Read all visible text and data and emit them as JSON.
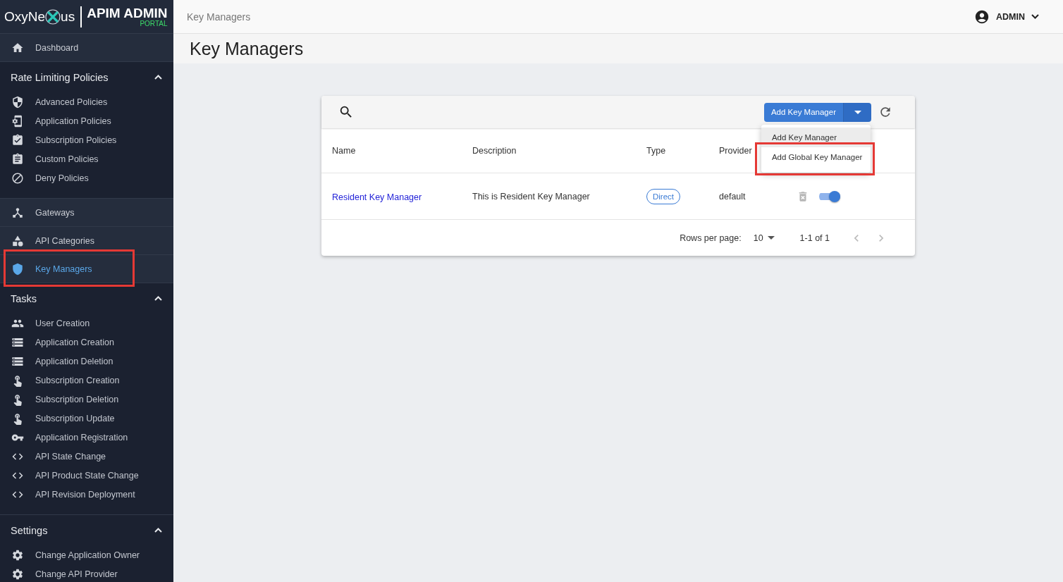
{
  "brand": {
    "logo_start": "OxyNe",
    "logo_end": "us",
    "product": "APIM ADMIN",
    "product_sub": "PORTAL"
  },
  "topbar": {
    "breadcrumb": "Key Managers",
    "user": "ADMIN"
  },
  "page_title": "Key Managers",
  "sidebar": {
    "sections": [
      {
        "kind": "link",
        "label": "Dashboard",
        "selected": false,
        "annotated": false
      },
      {
        "kind": "group",
        "title": "Rate Limiting Policies",
        "expanded": true,
        "items": [
          {
            "label": "Advanced Policies",
            "selected": false
          },
          {
            "label": "Application Policies",
            "selected": false
          },
          {
            "label": "Subscription Policies",
            "selected": false
          },
          {
            "label": "Custom Policies",
            "selected": false
          },
          {
            "label": "Deny Policies",
            "selected": false
          }
        ]
      },
      {
        "kind": "link",
        "label": "Gateways",
        "selected": false,
        "annotated": false
      },
      {
        "kind": "link",
        "label": "API Categories",
        "selected": false,
        "annotated": false
      },
      {
        "kind": "link",
        "label": "Key Managers",
        "selected": true,
        "annotated": true
      },
      {
        "kind": "group",
        "title": "Tasks",
        "expanded": true,
        "items": [
          {
            "label": "User Creation",
            "selected": false
          },
          {
            "label": "Application Creation",
            "selected": false
          },
          {
            "label": "Application Deletion",
            "selected": false
          },
          {
            "label": "Subscription Creation",
            "selected": false
          },
          {
            "label": "Subscription Deletion",
            "selected": false
          },
          {
            "label": "Subscription Update",
            "selected": false
          },
          {
            "label": "Application Registration",
            "selected": false
          },
          {
            "label": "API State Change",
            "selected": false
          },
          {
            "label": "API Product State Change",
            "selected": false
          },
          {
            "label": "API Revision Deployment",
            "selected": false
          }
        ]
      },
      {
        "kind": "group",
        "title": "Settings",
        "expanded": true,
        "items": [
          {
            "label": "Change Application Owner",
            "selected": false
          },
          {
            "label": "Change API Provider",
            "selected": false
          }
        ]
      }
    ]
  },
  "toolbar": {
    "add_button": "Add Key Manager",
    "menu_open": true,
    "menu": [
      {
        "label": "Add Key Manager",
        "hovered": true,
        "annotated": false
      },
      {
        "label": "Add Global Key Manager",
        "hovered": false,
        "annotated": true
      }
    ]
  },
  "table": {
    "columns": [
      "Name",
      "Description",
      "Type",
      "Provider"
    ],
    "rows": [
      {
        "name": "Resident Key Manager",
        "description": "This is Resident Key Manager",
        "type": "Direct",
        "provider": "default",
        "enabled": true
      }
    ]
  },
  "pagination": {
    "rows_per_page_label": "Rows per page:",
    "rows_per_page": "10",
    "range": "1-1 of 1"
  }
}
